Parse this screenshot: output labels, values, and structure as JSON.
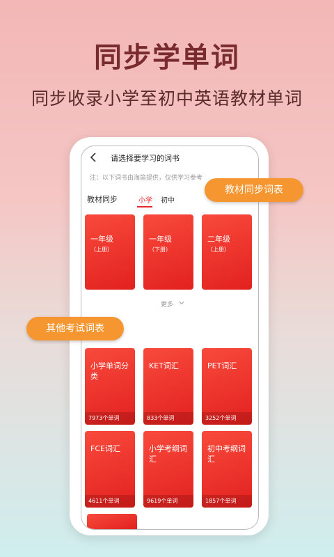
{
  "hero": {
    "title": "同步学单词",
    "subtitle": "同步收录小学至初中英语教材单词"
  },
  "screen": {
    "title": "请选择要学习的词书",
    "note": "注：以下词书由海笛提供，仅供学习参考",
    "section_label": "教材同步",
    "tabs": [
      {
        "label": "小学",
        "active": true
      },
      {
        "label": "初中",
        "active": false
      }
    ],
    "textbooks": [
      {
        "title": "一年级",
        "sub": "（上册）"
      },
      {
        "title": "一年级",
        "sub": "（下册）"
      },
      {
        "title": "二年级",
        "sub": "（上册）"
      }
    ],
    "more_label": "更多",
    "exam_books": [
      {
        "title": "小学单词分类",
        "count": "7973个单词"
      },
      {
        "title": "KET词汇",
        "count": "833个单词"
      },
      {
        "title": "PET词汇",
        "count": "3252个单词"
      },
      {
        "title": "FCE词汇",
        "count": "4611个单词"
      },
      {
        "title": "小学考纲词汇",
        "count": "9619个单词"
      },
      {
        "title": "初中考纲词汇",
        "count": "1857个单词"
      }
    ]
  },
  "callouts": {
    "textbook": "教材同步词表",
    "exam": "其他考试词表"
  },
  "colors": {
    "accent": "#e5262c",
    "card_red": "#f03a30",
    "callout_orange": "#f59630",
    "title_color": "#7a2b2d"
  }
}
